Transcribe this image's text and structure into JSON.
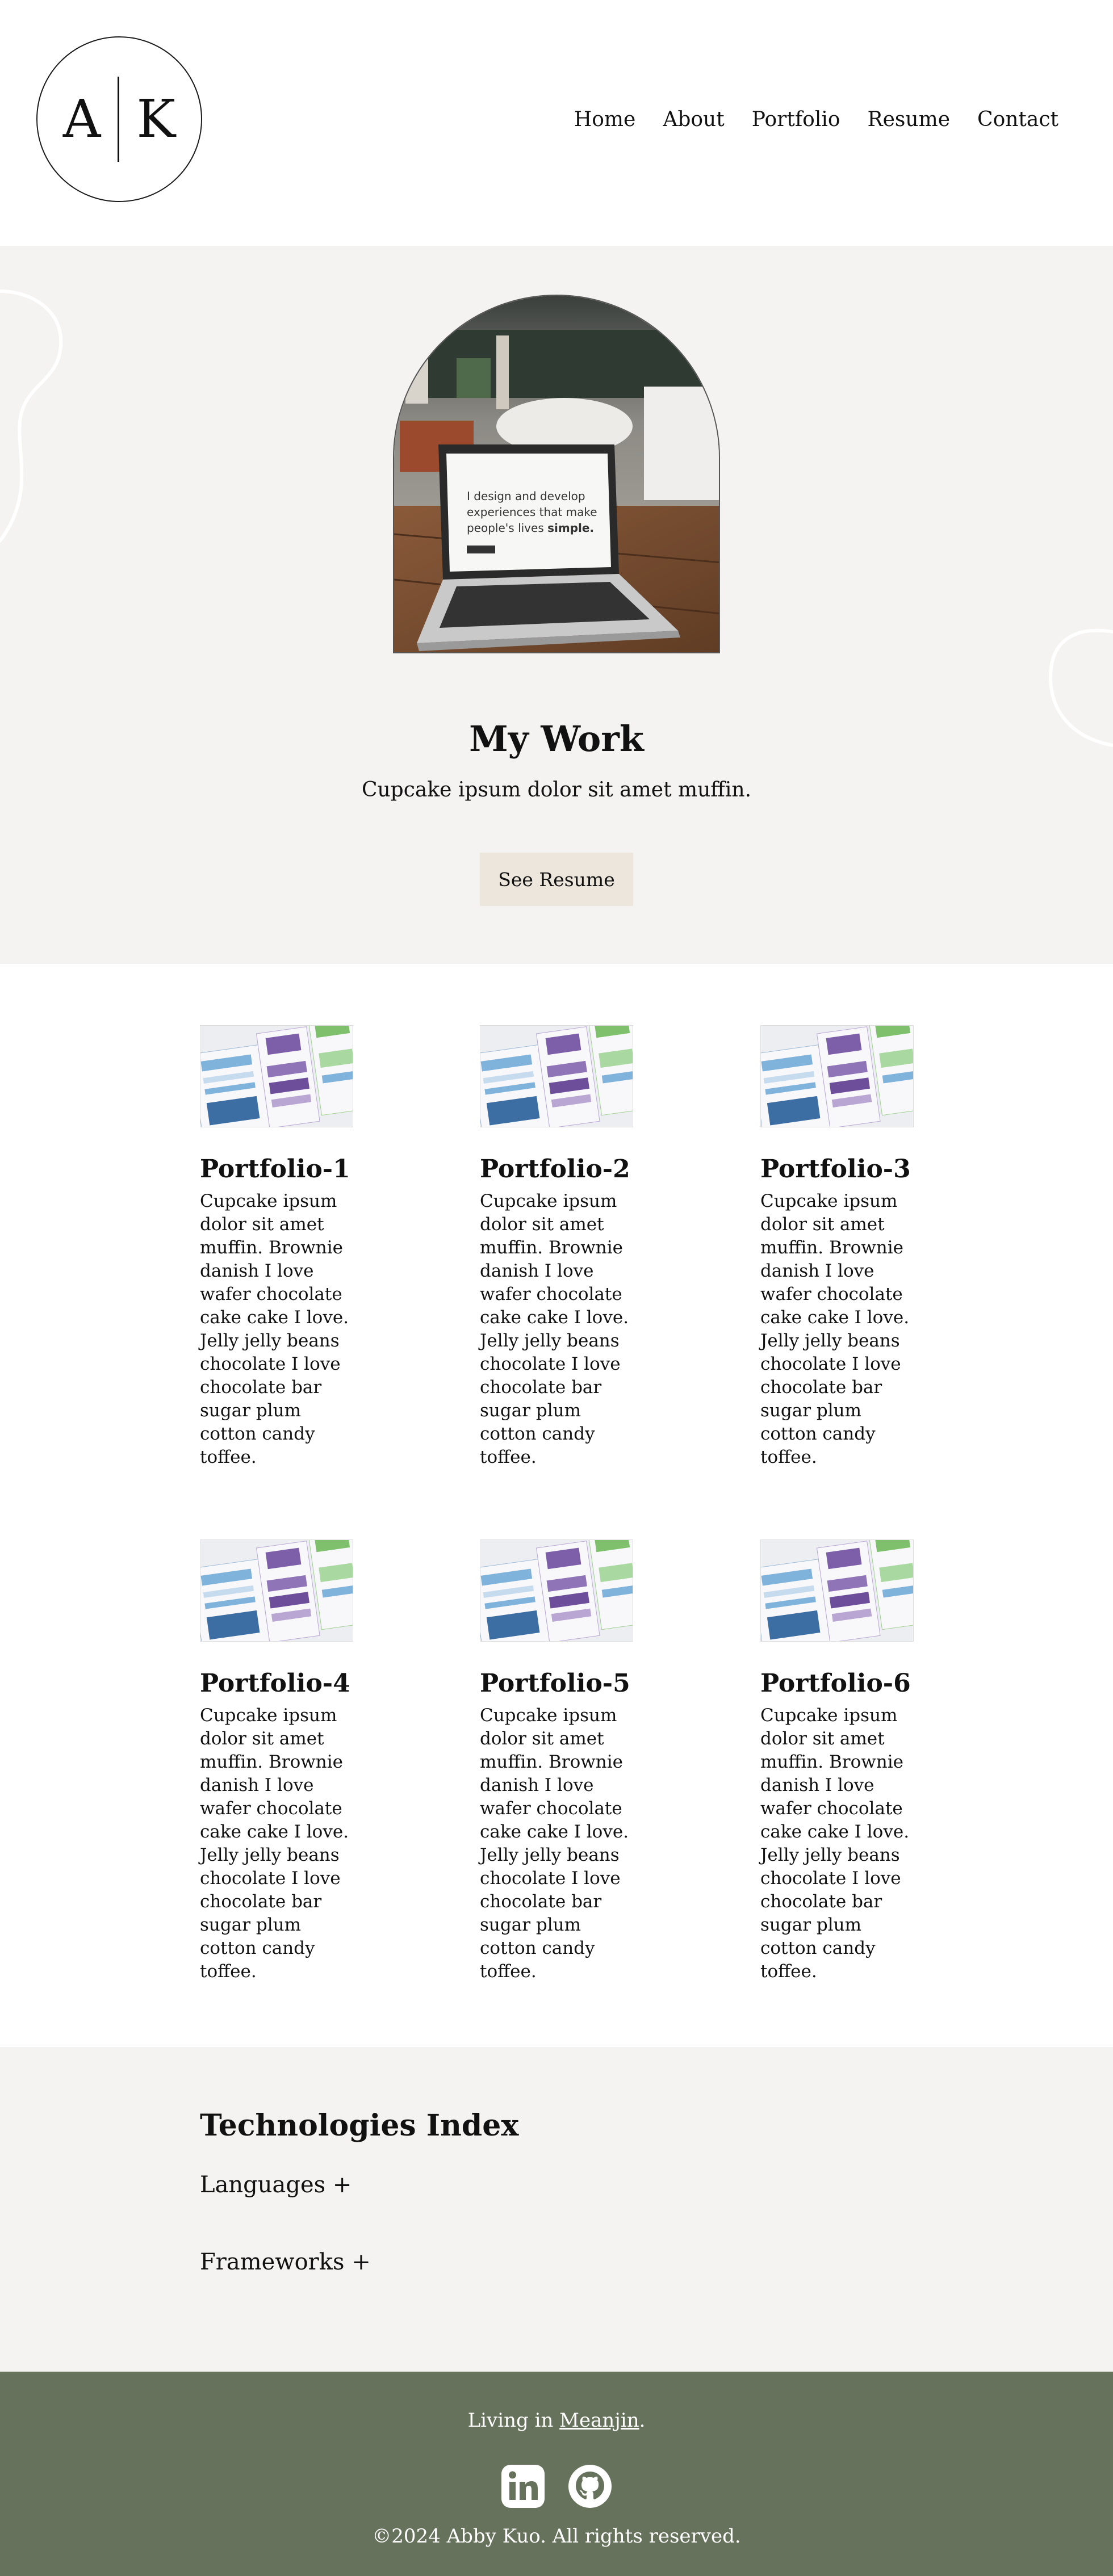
{
  "header": {
    "logo": {
      "left_letter": "A",
      "right_letter": "K"
    },
    "nav": [
      {
        "label": "Home"
      },
      {
        "label": "About"
      },
      {
        "label": "Portfolio"
      },
      {
        "label": "Resume"
      },
      {
        "label": "Contact"
      }
    ]
  },
  "hero": {
    "laptop_screen_text": {
      "line1": "I design and develop",
      "line2": "experiences that make",
      "line3": "people's lives ",
      "line3_bold": "simple."
    },
    "title": "My Work",
    "subtitle": "Cupcake ipsum dolor sit amet muffin.",
    "button_label": "See Resume"
  },
  "portfolio": {
    "items": [
      {
        "title": "Portfolio-1",
        "description": "Cupcake ipsum dolor sit amet muffin. Brownie danish I love wafer chocolate cake cake I love. Jelly jelly beans chocolate I love chocolate bar sugar plum cotton candy toffee."
      },
      {
        "title": "Portfolio-2",
        "description": "Cupcake ipsum dolor sit amet muffin. Brownie danish I love wafer chocolate cake cake I love. Jelly jelly beans chocolate I love chocolate bar sugar plum cotton candy toffee."
      },
      {
        "title": "Portfolio-3",
        "description": "Cupcake ipsum dolor sit amet muffin. Brownie danish I love wafer chocolate cake cake I love. Jelly jelly beans chocolate I love chocolate bar sugar plum cotton candy toffee."
      },
      {
        "title": "Portfolio-4",
        "description": "Cupcake ipsum dolor sit amet muffin. Brownie danish I love wafer chocolate cake cake I love. Jelly jelly beans chocolate I love chocolate bar sugar plum cotton candy toffee."
      },
      {
        "title": "Portfolio-5",
        "description": "Cupcake ipsum dolor sit amet muffin. Brownie danish I love wafer chocolate cake cake I love. Jelly jelly beans chocolate I love chocolate bar sugar plum cotton candy toffee."
      },
      {
        "title": "Portfolio-6",
        "description": "Cupcake ipsum dolor sit amet muffin. Brownie danish I love wafer chocolate cake cake I love. Jelly jelly beans chocolate I love chocolate bar sugar plum cotton candy toffee."
      }
    ]
  },
  "technologies": {
    "heading": "Technologies Index",
    "sections": [
      {
        "label": "Languages +"
      },
      {
        "label": "Frameworks +"
      }
    ]
  },
  "footer": {
    "living_prefix": "Living in ",
    "living_link": "Meanjin",
    "living_suffix": ".",
    "social_icons": [
      "linkedin-icon",
      "github-icon"
    ],
    "copyright": "©2024 Abby Kuo. All rights reserved."
  },
  "colors": {
    "page_bg": "#ffffff",
    "section_bg": "#f5f3f1",
    "button_bg": "#ede6dc",
    "footer_bg": "#66725b",
    "text": "#111111"
  }
}
